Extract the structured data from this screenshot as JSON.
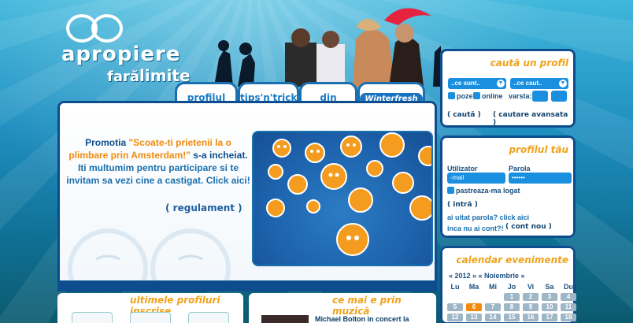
{
  "logo": {
    "line1": "apropiere",
    "line2_pre": "fară",
    "line2_main": "limite"
  },
  "tabs": [
    {
      "label": "profilul tău"
    },
    {
      "label": "tips'n'tricks"
    },
    {
      "label": "din muzică"
    },
    {
      "label": "Winterfresh"
    }
  ],
  "promo": {
    "prefix": "Promotia ",
    "highlight": "\"Scoate-ti prietenii la o plimbare prin Amsterdam!\"",
    "mid": " s-a incheiat.",
    "line2": "Iti multumim pentru participare si te invitam sa vezi cine a castigat. ",
    "cta": "Click aici!",
    "reg_button": "regulament"
  },
  "search_profile": {
    "title": "caută un profil",
    "select1": "..ce sunt..",
    "select2": "..ce caut..",
    "chk_photos": "poze",
    "chk_online": "online",
    "age_label": "varsta:",
    "search_btn": "caută",
    "advanced_btn": "cautare avansata"
  },
  "your_profile": {
    "title": "profilul tău",
    "user_label": "Utilizator",
    "pass_label": "Parola",
    "user_placeholder": "-mail",
    "pass_value": "••••••",
    "remember": "pastreaza-ma logat",
    "login_btn": "intră",
    "forgot": "ai uitat parola? click aici",
    "no_account": "inca nu ai cont?!",
    "new_account_btn": "cont nou"
  },
  "calendar": {
    "title": "calendar evenimente",
    "nav": "« 2012 » « Noiembrie »",
    "weekdays": [
      "Lu",
      "Ma",
      "Mi",
      "Jo",
      "Vi",
      "Sa",
      "Du"
    ],
    "row1": [
      "",
      "",
      "",
      "1",
      "2",
      "3",
      "4"
    ],
    "row2": [
      "5",
      "6",
      "7",
      "8",
      "9",
      "10",
      "11"
    ],
    "row3": [
      "12",
      "13",
      "14",
      "15",
      "16",
      "17",
      "18"
    ]
  },
  "bottom": {
    "latest_title": "ultimele profiluri inscrise",
    "music_title": "ce mai e prin muzică",
    "news_headline": "Michael Bolton in concert la"
  },
  "colors": {
    "accent": "#f08a0c",
    "brand_blue": "#1a6fae",
    "dark_blue": "#0d4d8e"
  }
}
